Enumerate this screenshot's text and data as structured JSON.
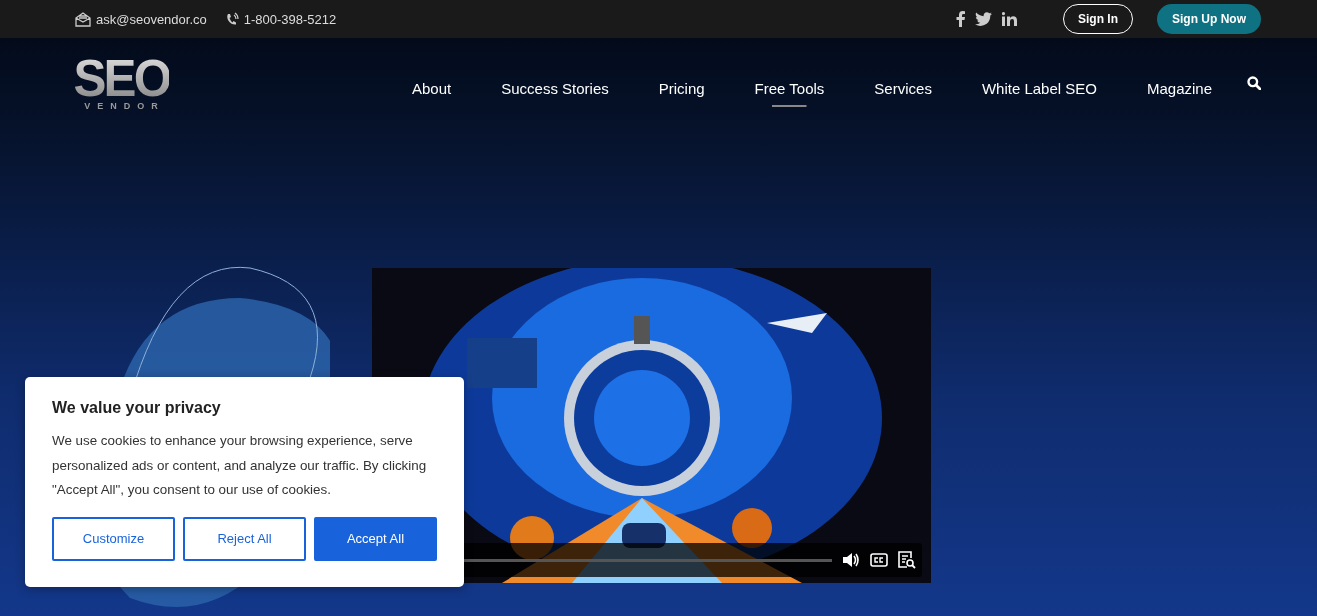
{
  "top_bar": {
    "email": "ask@seovendor.co",
    "phone": "1-800-398-5212",
    "buttons": [
      {
        "label": "Sign In",
        "kind": "outline"
      },
      {
        "label": "Sign Up Now",
        "kind": "filled"
      }
    ]
  },
  "logo": {
    "title": "SEO",
    "subtitle": "VENDOR"
  },
  "nav": [
    {
      "label": "About",
      "selected": false
    },
    {
      "label": "Success Stories",
      "selected": false
    },
    {
      "label": "Pricing",
      "selected": false
    },
    {
      "label": "Free Tools",
      "selected": true
    },
    {
      "label": "Services",
      "selected": false
    },
    {
      "label": "White Label SEO",
      "selected": false
    },
    {
      "label": "Magazine",
      "selected": false
    }
  ],
  "cookie_dialog": {
    "title": "We value your privacy",
    "text": "We use cookies to enhance your browsing experience, serve personalized ads or content, and analyze our traffic. By clicking \"Accept All\", you consent to our use of cookies.",
    "buttons": [
      {
        "label": "Customize",
        "kind": "outline"
      },
      {
        "label": "Reject All",
        "kind": "outline"
      },
      {
        "label": "Accept All",
        "kind": "filled"
      }
    ]
  }
}
